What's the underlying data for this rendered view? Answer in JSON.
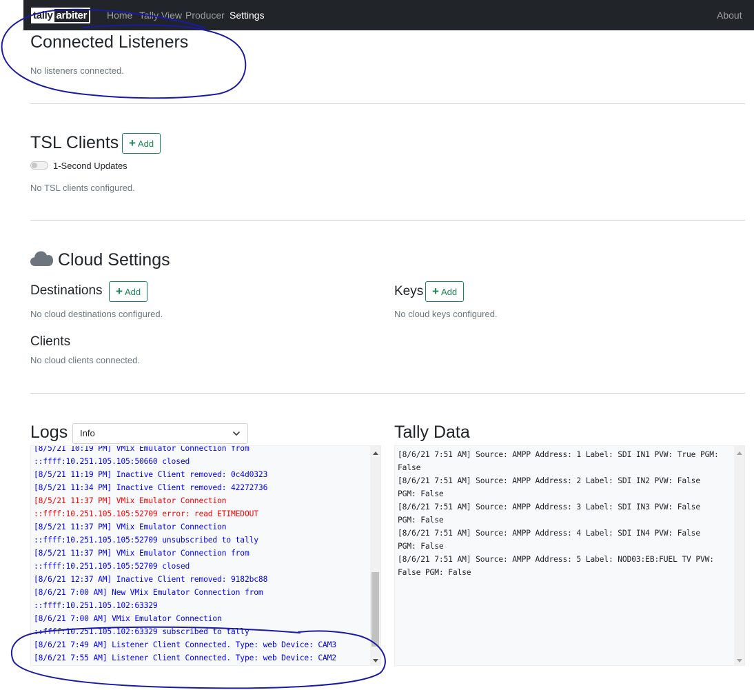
{
  "navbar": {
    "brand_part1": "tally",
    "brand_part2": "arbiter",
    "links": [
      "Home",
      "Tally View",
      "Producer",
      "Settings"
    ],
    "about": "About",
    "active": "Settings"
  },
  "listeners": {
    "title": "Connected Listeners",
    "empty": "No listeners connected."
  },
  "tsl": {
    "title": "TSL Clients",
    "add_label": "Add",
    "toggle_label": "1-Second Updates",
    "empty": "No TSL clients configured."
  },
  "cloud": {
    "title": "Cloud Settings",
    "icon": "cloud-icon",
    "destinations": {
      "title": "Destinations",
      "add_label": "Add",
      "empty": "No cloud destinations configured."
    },
    "keys": {
      "title": "Keys",
      "add_label": "Add",
      "empty": "No cloud keys configured."
    },
    "clients": {
      "title": "Clients",
      "empty": "No cloud clients connected."
    }
  },
  "logs": {
    "title": "Logs",
    "level_selected": "Info",
    "lines": [
      {
        "text": "[8/5/21 10:19 PM] VMix Emulator Connection from",
        "color": "#0000ff"
      },
      {
        "text": "::ffff:10.251.105.105:50660 closed",
        "color": "#0000ff"
      },
      {
        "text": "[8/5/21 11:19 PM] Inactive Client removed: 0c4d0323",
        "color": "#0000ff"
      },
      {
        "text": "[8/5/21 11:34 PM] Inactive Client removed: 42272736",
        "color": "#0000ff"
      },
      {
        "text": "[8/5/21 11:37 PM] VMix Emulator Connection",
        "color": "#ff0000"
      },
      {
        "text": "::ffff:10.251.105.105:52709 error: read ETIMEDOUT",
        "color": "#ff0000"
      },
      {
        "text": "[8/5/21 11:37 PM] VMix Emulator Connection",
        "color": "#0000ff"
      },
      {
        "text": "::ffff:10.251.105.105:52709 unsubscribed to tally",
        "color": "#0000ff"
      },
      {
        "text": "[8/5/21 11:37 PM] VMix Emulator Connection from",
        "color": "#0000ff"
      },
      {
        "text": "::ffff:10.251.105.105:52709 closed",
        "color": "#0000ff"
      },
      {
        "text": "[8/6/21 12:37 AM] Inactive Client removed: 9182bc88",
        "color": "#0000ff"
      },
      {
        "text": "[8/6/21 7:00 AM] New VMix Emulator Connection from",
        "color": "#0000ff"
      },
      {
        "text": "::ffff:10.251.105.102:63329",
        "color": "#0000ff"
      },
      {
        "text": "[8/6/21 7:00 AM] VMix Emulator Connection",
        "color": "#0000ff"
      },
      {
        "text": "::ffff:10.251.105.102:63329 subscribed to tally",
        "color": "#0000ff"
      },
      {
        "text": "[8/6/21 7:49 AM] Listener Client Connected. Type: web Device: CAM3",
        "color": "#0000ff"
      },
      {
        "text": "[8/6/21 7:55 AM] Listener Client Connected. Type: web Device: CAM2",
        "color": "#0000ff"
      }
    ],
    "scroll_position": 0.95
  },
  "tally": {
    "title": "Tally Data",
    "lines": [
      "[8/6/21 7:51 AM] Source: AMPP Address: 1 Label: SDI IN1 PVW: True PGM: False",
      "[8/6/21 7:51 AM] Source: AMPP Address: 2 Label: SDI IN2 PVW: False PGM: False",
      "[8/6/21 7:51 AM] Source: AMPP Address: 3 Label: SDI IN3 PVW: False PGM: False",
      "[8/6/21 7:51 AM] Source: AMPP Address: 4 Label: SDI IN4 PVW: False PGM: False",
      "[8/6/21 7:51 AM] Source: AMPP Address: 5 Label: NOD03:EB:FUEL TV PVW: False PGM: False"
    ]
  },
  "colors": {
    "navbar_bg": "#212529",
    "success": "#198754",
    "log_info": "#0000ff",
    "log_error": "#ff0000",
    "annotation_ink": "#1a1aa6"
  }
}
